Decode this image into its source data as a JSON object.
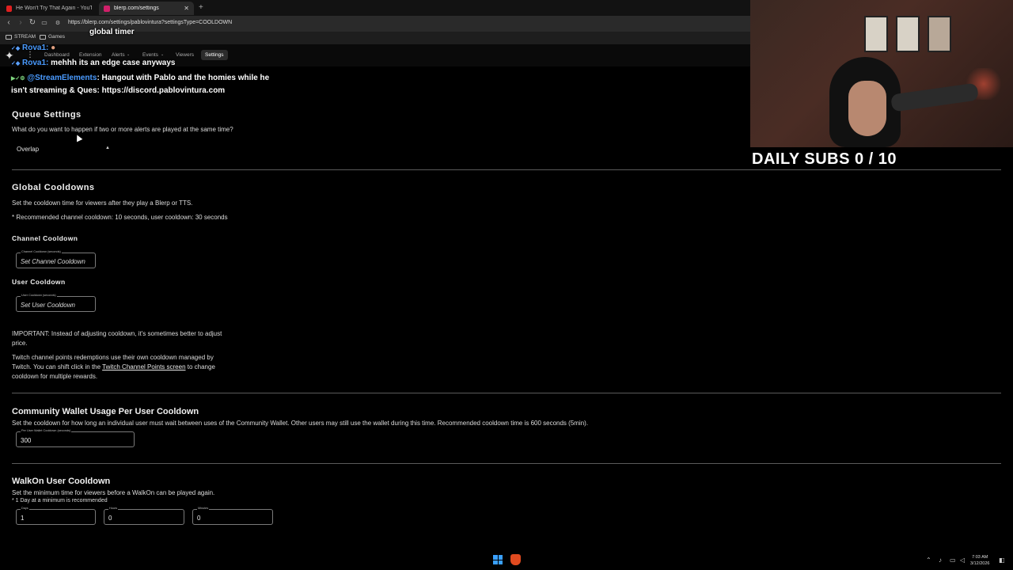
{
  "browser": {
    "tabs": [
      {
        "label": "He Won't Try That Again - YouTube",
        "fav_color": "#e02020"
      },
      {
        "label": "blerp.com/settings",
        "fav_color": "#d0206a"
      }
    ],
    "url": "https://blerp.com/settings/pablovintura?settingsType=COOLDOWN",
    "bookmarks": [
      {
        "label": "STREAM"
      },
      {
        "label": "Games"
      }
    ]
  },
  "nav": {
    "items": [
      "Dashboard",
      "Extension",
      "Alerts",
      "Events",
      "Viewers",
      "Settings"
    ],
    "active": "Settings"
  },
  "chat": [
    {
      "user": "",
      "message": "global timer"
    },
    {
      "user": "Rova1:",
      "message": ""
    },
    {
      "user": "Rova1:",
      "message": "mehhh its an edge case anyways"
    },
    {
      "user": "@StreamElements",
      "message": ": Hangout with Pablo and the homies while he"
    },
    {
      "user": "",
      "message": "isn't streaming & Ques: https://discord.pablovintura.com"
    }
  ],
  "queue": {
    "title": "Queue Settings",
    "question": "What do you want to happen if two or more alerts are played at the same time?",
    "selected": "Overlap"
  },
  "global": {
    "title": "Global Cooldowns",
    "desc": "Set the cooldown time for viewers after they play a Blerp or TTS.",
    "recommend": "* Recommended channel cooldown: 10 seconds, user cooldown: 30 seconds",
    "channel": {
      "title": "Channel Cooldown",
      "field_label": "Channel Cooldown (seconds)",
      "placeholder": "Set Channel Cooldown"
    },
    "user": {
      "title": "User Cooldown",
      "field_label": "User Cooldown (seconds)",
      "placeholder": "Set User Cooldown"
    },
    "important_1": "IMPORTANT: Instead of adjusting cooldown, it's sometimes better to adjust",
    "important_2": "price.",
    "twitch_1": "Twitch channel points redemptions use their own cooldown managed by",
    "twitch_2a": "Twitch. You can shift click in the ",
    "twitch_link": "Twitch Channel Points screen",
    "twitch_2b": " to change",
    "twitch_3": "cooldown for multiple rewards."
  },
  "wallet": {
    "title": "Community Wallet Usage Per User Cooldown",
    "desc": "Set the cooldown for how long an individual user must wait between uses of the Community Wallet. Other users may still use the wallet during this time. Recommended cooldown time is 600 seconds (5min).",
    "field_label": "Per User Wallet Cooldown (seconds)",
    "value": "300"
  },
  "walkon": {
    "title": "WalkOn User Cooldown",
    "desc": "Set the minimum time for viewers before a WalkOn can be played again.",
    "note": "* 1 Day at a minimum is recommended",
    "fields": [
      {
        "label": "Days",
        "value": "1"
      },
      {
        "label": "Hours",
        "value": "0"
      },
      {
        "label": "Minutes",
        "value": "0"
      }
    ]
  },
  "overlay": {
    "daily_subs": "DAILY SUBS 0 / 10"
  },
  "taskbar": {
    "time": "7:03 AM",
    "date": "3/12/2026"
  },
  "colors": {
    "accent_link": "#4a9bff",
    "windows_blue": "#3aa0ff",
    "brave_orange": "#e04a1f"
  }
}
